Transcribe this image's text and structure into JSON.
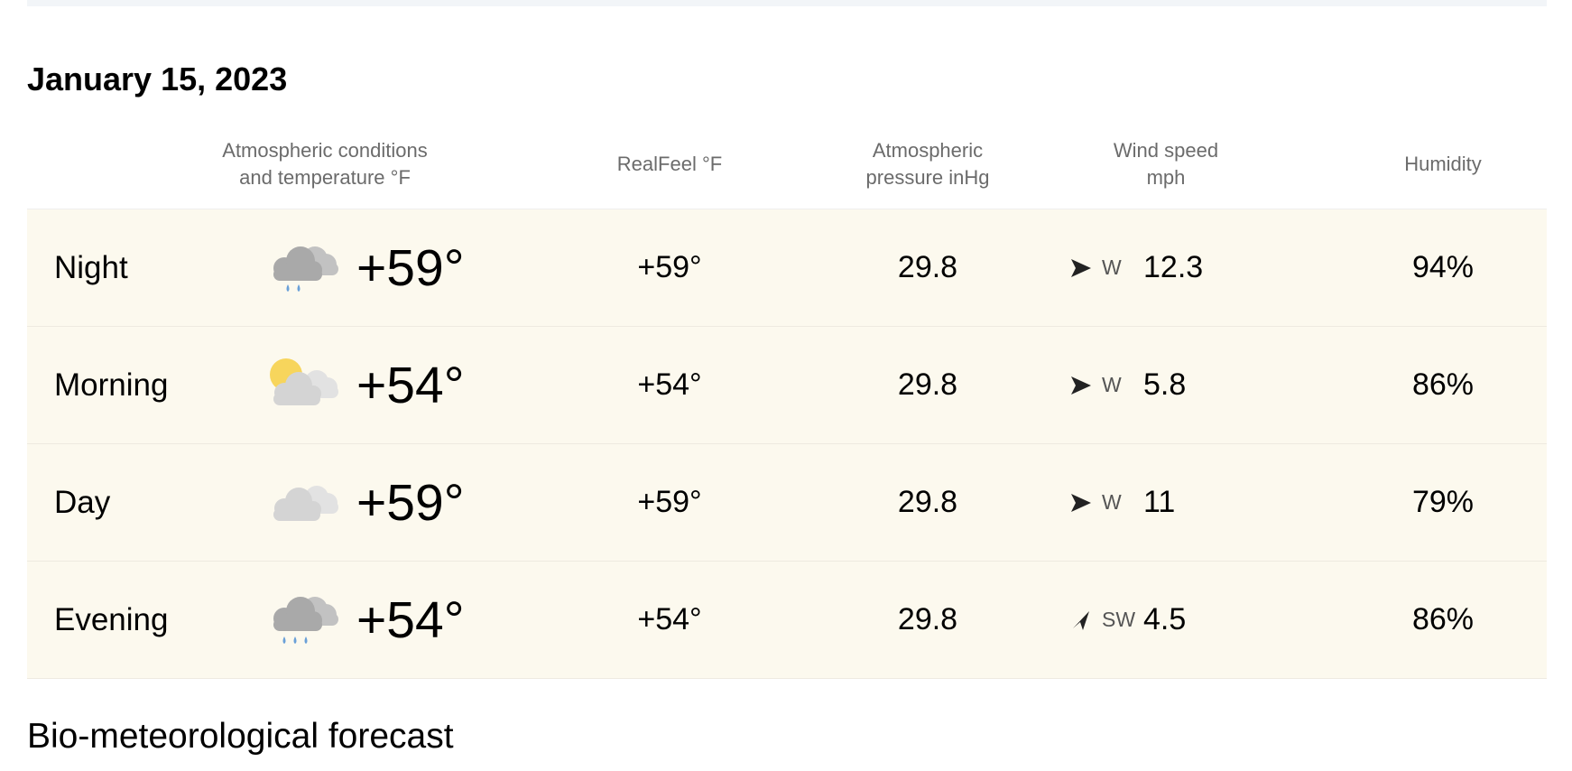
{
  "date_title": "January 15, 2023",
  "columns": {
    "conditions": "Atmospheric conditions\nand temperature °F",
    "realfeel": "RealFeel °F",
    "pressure": "Atmospheric\npressure inHg",
    "wind": "Wind speed\nmph",
    "humidity": "Humidity"
  },
  "rows": [
    {
      "name": "Night",
      "icon": "cloudy-light-rain-icon",
      "temp": "+59°",
      "realfeel": "+59°",
      "pressure": "29.8",
      "wind_dir": "W",
      "wind_speed": "12.3",
      "humidity": "94%"
    },
    {
      "name": "Morning",
      "icon": "partly-cloudy-sun-icon",
      "temp": "+54°",
      "realfeel": "+54°",
      "pressure": "29.8",
      "wind_dir": "W",
      "wind_speed": "5.8",
      "humidity": "86%"
    },
    {
      "name": "Day",
      "icon": "cloudy-icon",
      "temp": "+59°",
      "realfeel": "+59°",
      "pressure": "29.8",
      "wind_dir": "W",
      "wind_speed": "11",
      "humidity": "79%"
    },
    {
      "name": "Evening",
      "icon": "cloudy-rain-icon",
      "temp": "+54°",
      "realfeel": "+54°",
      "pressure": "29.8",
      "wind_dir": "SW",
      "wind_speed": "4.5",
      "humidity": "86%"
    }
  ],
  "section_title": "Bio-meteorological forecast",
  "colors": {
    "row_background": "#fcf9ee",
    "header_text": "#6b6b6b",
    "rain_drop": "#6aa0d8",
    "sun": "#f7d55c",
    "dark_cloud": "#b0b0b0",
    "light_cloud": "#d8d8d8"
  }
}
